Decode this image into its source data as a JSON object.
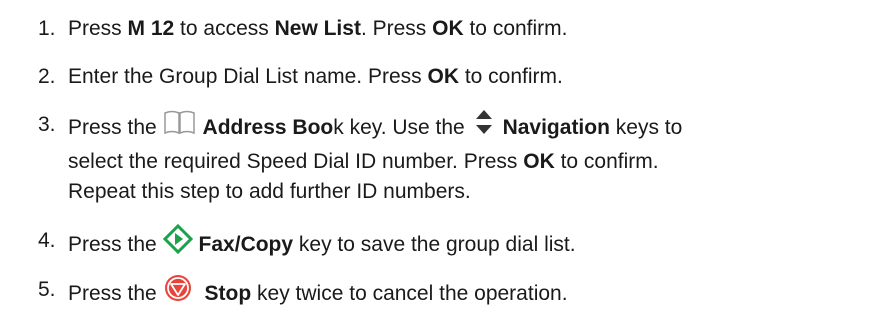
{
  "steps": [
    {
      "num": "1.",
      "t1": "Press ",
      "b1": "M 12",
      "t2": " to access ",
      "b2": "New List",
      "t3": ". Press ",
      "b3": "OK",
      "t4": " to confirm."
    },
    {
      "num": "2.",
      "t1": "Enter the Group Dial List name.  Press ",
      "b1": "OK",
      "t2": " to confirm."
    },
    {
      "num": "3.",
      "t1": "Press the ",
      "icon1": "book-icon",
      "b1": "Address Boo",
      "t2": "k key.  Use the ",
      "icon2": "up-down-arrows-icon",
      "b2": "Navigation",
      "t3": " keys to",
      "t4": "select the required Speed Dial ID number. Press ",
      "b3": "OK",
      "t5": " to confirm.",
      "t6": "Repeat this step to add further ID numbers."
    },
    {
      "num": "4.",
      "t1": "Press the ",
      "icon1": "diamond-start-icon",
      "b1": "Fax/Copy",
      "t2": " key to save the group dial list."
    },
    {
      "num": "5.",
      "t1": "Press the ",
      "icon1": "stop-icon",
      "b1": "Stop",
      "t2": " key twice to cancel the operation."
    }
  ],
  "colors": {
    "text": "#1a1a1a",
    "start_green": "#1aa14a",
    "stop_red": "#e8443a",
    "arrow_dark": "#333333",
    "book_grey": "#999999"
  }
}
